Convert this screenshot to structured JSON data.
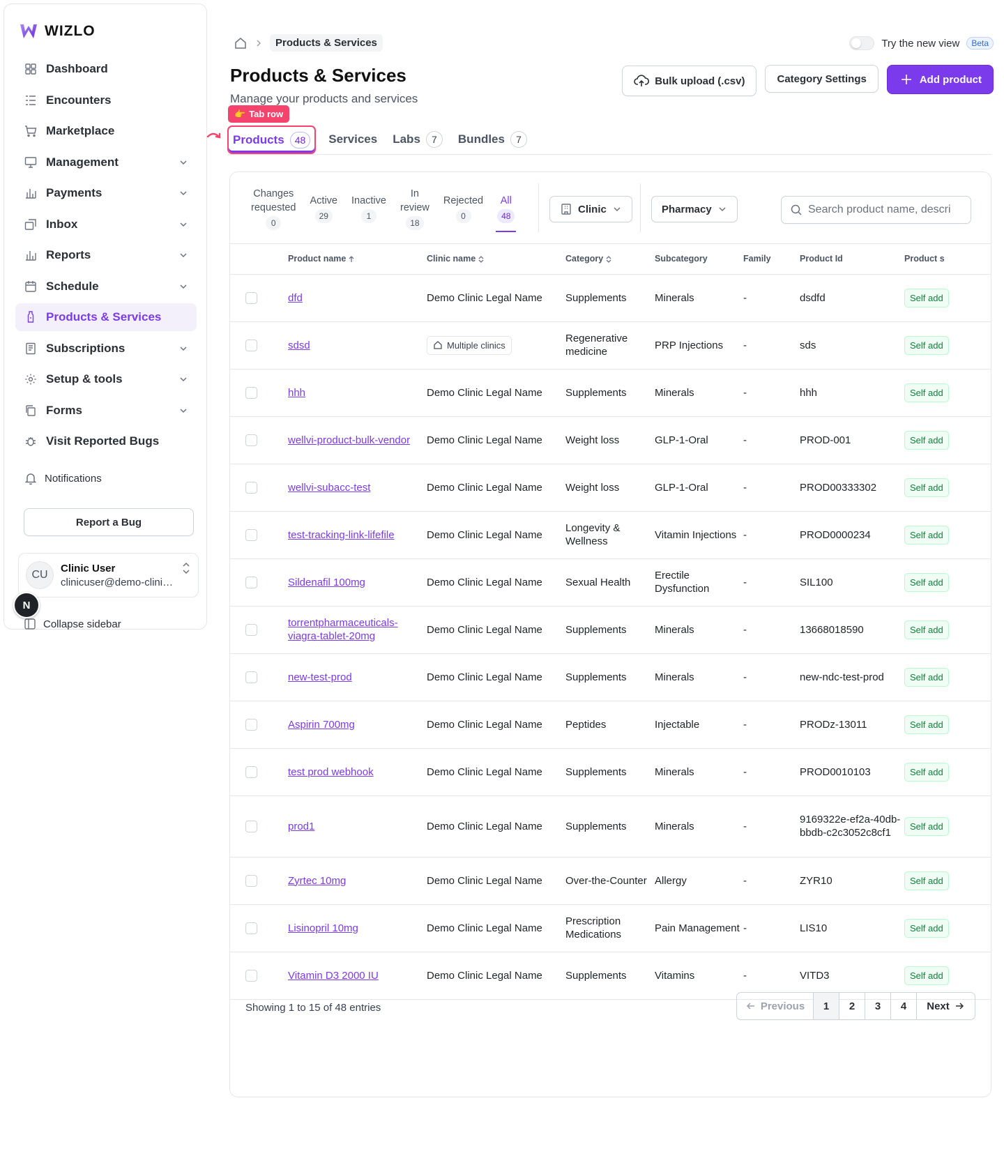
{
  "brand": {
    "name": "WIZLO"
  },
  "sidebar": {
    "items": [
      {
        "label": "Dashboard",
        "icon": "dashboard-icon",
        "chevron": false,
        "active": false
      },
      {
        "label": "Encounters",
        "icon": "encounters-icon",
        "chevron": false,
        "active": false
      },
      {
        "label": "Marketplace",
        "icon": "cart-icon",
        "chevron": false,
        "active": false
      },
      {
        "label": "Management",
        "icon": "monitor-icon",
        "chevron": true,
        "active": false
      },
      {
        "label": "Payments",
        "icon": "bar-chart-icon",
        "chevron": true,
        "active": false
      },
      {
        "label": "Inbox",
        "icon": "inbox-icon",
        "chevron": true,
        "active": false
      },
      {
        "label": "Reports",
        "icon": "bar-chart-icon",
        "chevron": true,
        "active": false
      },
      {
        "label": "Schedule",
        "icon": "calendar-icon",
        "chevron": true,
        "active": false
      },
      {
        "label": "Products & Services",
        "icon": "bottle-icon",
        "chevron": false,
        "active": true
      },
      {
        "label": "Subscriptions",
        "icon": "document-icon",
        "chevron": true,
        "active": false
      },
      {
        "label": "Setup & tools",
        "icon": "gear-icon",
        "chevron": true,
        "active": false
      },
      {
        "label": "Forms",
        "icon": "copy-icon",
        "chevron": true,
        "active": false
      },
      {
        "label": "Visit Reported Bugs",
        "icon": "bug-icon",
        "chevron": false,
        "active": false
      }
    ],
    "notifications_label": "Notifications",
    "report_bug_label": "Report a Bug",
    "user": {
      "initials": "CU",
      "name": "Clinic User",
      "email": "clinicuser@demo-clinic.c..."
    },
    "collapse_label": "Collapse sidebar",
    "floating_badge": "N"
  },
  "header": {
    "breadcrumb_current": "Products & Services",
    "try_new_view": "Try the new view",
    "beta": "Beta",
    "title": "Products & Services",
    "subtitle": "Manage your products and services",
    "bulk_upload": "Bulk upload (.csv)",
    "category_settings": "Category Settings",
    "add_product": "Add product"
  },
  "annotation": {
    "label": "Tab row"
  },
  "tabs": [
    {
      "label": "Products",
      "count": "48",
      "active": true
    },
    {
      "label": "Services",
      "count": "",
      "active": false
    },
    {
      "label": "Labs",
      "count": "7",
      "active": false
    },
    {
      "label": "Bundles",
      "count": "7",
      "active": false
    }
  ],
  "status_tabs": [
    {
      "label": "Changes requested",
      "line1": "Changes",
      "line2": "requested",
      "count": "0",
      "active": false
    },
    {
      "label": "Active",
      "line1": "Active",
      "line2": "",
      "count": "29",
      "active": false
    },
    {
      "label": "Inactive",
      "line1": "Inactive",
      "line2": "",
      "count": "1",
      "active": false
    },
    {
      "label": "In review",
      "line1": "In",
      "line2": "review",
      "count": "18",
      "active": false
    },
    {
      "label": "Rejected",
      "line1": "Rejected",
      "line2": "",
      "count": "0",
      "active": false
    },
    {
      "label": "All",
      "line1": "All",
      "line2": "",
      "count": "48",
      "active": true
    }
  ],
  "filters": {
    "clinic": "Clinic",
    "pharmacy": "Pharmacy",
    "search_placeholder": "Search product name, descri"
  },
  "table": {
    "columns": [
      "Product name",
      "Clinic name",
      "Category",
      "Subcategory",
      "Family",
      "Product Id",
      "Product s"
    ],
    "rows": [
      {
        "name": "dfd",
        "clinic": "Demo Clinic Legal Name",
        "multi": false,
        "category": "Supplements",
        "subcategory": "Minerals",
        "family": "-",
        "pid": "dsdfd",
        "status": "Self add"
      },
      {
        "name": "sdsd",
        "clinic": "Multiple clinics",
        "multi": true,
        "category": "Regenerative medicine",
        "subcategory": "PRP Injections",
        "family": "-",
        "pid": "sds",
        "status": "Self add"
      },
      {
        "name": "hhh",
        "clinic": "Demo Clinic Legal Name",
        "multi": false,
        "category": "Supplements",
        "subcategory": "Minerals",
        "family": "-",
        "pid": "hhh",
        "status": "Self add"
      },
      {
        "name": "wellvi-product-bulk-vendor",
        "clinic": "Demo Clinic Legal Name",
        "multi": false,
        "category": "Weight loss",
        "subcategory": "GLP-1-Oral",
        "family": "-",
        "pid": "PROD-001",
        "status": "Self add"
      },
      {
        "name": "wellvi-subacc-test",
        "clinic": "Demo Clinic Legal Name",
        "multi": false,
        "category": "Weight loss",
        "subcategory": "GLP-1-Oral",
        "family": "-",
        "pid": "PROD00333302",
        "status": "Self add"
      },
      {
        "name": "test-tracking-link-lifefile",
        "clinic": "Demo Clinic Legal Name",
        "multi": false,
        "category": "Longevity & Wellness",
        "subcategory": "Vitamin Injections",
        "family": "-",
        "pid": "PROD0000234",
        "status": "Self add"
      },
      {
        "name": "Sildenafil 100mg",
        "clinic": "Demo Clinic Legal Name",
        "multi": false,
        "category": "Sexual Health",
        "subcategory": "Erectile Dysfunction",
        "family": "-",
        "pid": "SIL100",
        "status": "Self add"
      },
      {
        "name": "torrentpharmaceuticals-viagra-tablet-20mg",
        "clinic": "Demo Clinic Legal Name",
        "multi": false,
        "category": "Supplements",
        "subcategory": "Minerals",
        "family": "-",
        "pid": "13668018590",
        "status": "Self add"
      },
      {
        "name": "new-test-prod",
        "clinic": "Demo Clinic Legal Name",
        "multi": false,
        "category": "Supplements",
        "subcategory": "Minerals",
        "family": "-",
        "pid": "new-ndc-test-prod",
        "status": "Self add"
      },
      {
        "name": "Aspirin 700mg",
        "clinic": "Demo Clinic Legal Name",
        "multi": false,
        "category": "Peptides",
        "subcategory": "Injectable",
        "family": "-",
        "pid": "PRODz-13011",
        "status": "Self add"
      },
      {
        "name": "test prod webhook",
        "clinic": "Demo Clinic Legal Name",
        "multi": false,
        "category": "Supplements",
        "subcategory": "Minerals",
        "family": "-",
        "pid": "PROD0010103",
        "status": "Self add"
      },
      {
        "name": "prod1",
        "clinic": "Demo Clinic Legal Name",
        "multi": false,
        "category": "Supplements",
        "subcategory": "Minerals",
        "family": "-",
        "pid": "9169322e-ef2a-40db-bbdb-c2c3052c8cf1",
        "status": "Self add",
        "tall": true
      },
      {
        "name": "Zyrtec 10mg",
        "clinic": "Demo Clinic Legal Name",
        "multi": false,
        "category": "Over-the-Counter",
        "subcategory": "Allergy",
        "family": "-",
        "pid": "ZYR10",
        "status": "Self add"
      },
      {
        "name": "Lisinopril 10mg",
        "clinic": "Demo Clinic Legal Name",
        "multi": false,
        "category": "Prescription Medications",
        "subcategory": "Pain Management",
        "family": "-",
        "pid": "LIS10",
        "status": "Self add"
      },
      {
        "name": "Vitamin D3 2000 IU",
        "clinic": "Demo Clinic Legal Name",
        "multi": false,
        "category": "Supplements",
        "subcategory": "Vitamins",
        "family": "-",
        "pid": "VITD3",
        "status": "Self add"
      }
    ]
  },
  "pagination": {
    "showing": "Showing 1 to 15 of 48 entries",
    "previous": "Previous",
    "pages": [
      "1",
      "2",
      "3",
      "4"
    ],
    "current": "1",
    "next": "Next"
  },
  "colors": {
    "accent": "#7c3aed",
    "annotation": "#f4436c",
    "status_green": "#15803d"
  }
}
